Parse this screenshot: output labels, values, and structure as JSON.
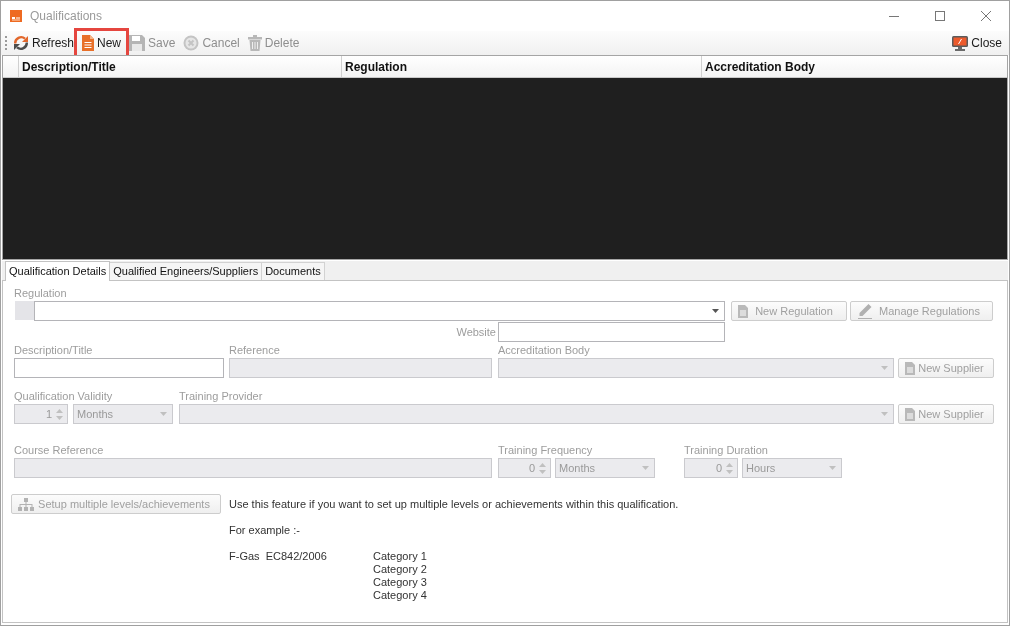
{
  "window": {
    "title": "Qualifications"
  },
  "toolbar": {
    "items": [
      {
        "kind": "refresh",
        "label": "Refresh",
        "disabled": false,
        "highlighted": false
      },
      {
        "kind": "new",
        "label": "New",
        "disabled": false,
        "highlighted": true
      },
      {
        "kind": "save",
        "label": "Save",
        "disabled": true,
        "highlighted": false
      },
      {
        "kind": "cancel",
        "label": "Cancel",
        "disabled": true,
        "highlighted": false
      },
      {
        "kind": "delete",
        "label": "Delete",
        "disabled": true,
        "highlighted": false
      }
    ],
    "close": {
      "label": "Close"
    }
  },
  "grid": {
    "columns": [
      "Description/Title",
      "Regulation",
      "Accreditation Body"
    ]
  },
  "tabs": [
    {
      "label": "Qualification Details",
      "selected": true
    },
    {
      "label": "Qualified Engineers/Suppliers",
      "selected": false
    },
    {
      "label": "Documents",
      "selected": false
    }
  ],
  "form": {
    "regulation": {
      "label": "Regulation",
      "disabled": false
    },
    "new_regulation": {
      "label": "New Regulation",
      "disabled": true
    },
    "manage_regulations": {
      "label": "Manage Regulations",
      "disabled": true
    },
    "website": {
      "label": "Website",
      "disabled": false
    },
    "description": {
      "label": "Description/Title",
      "disabled": false
    },
    "reference": {
      "label": "Reference",
      "disabled": true
    },
    "accreditation_body": {
      "label": "Accreditation Body",
      "disabled": true
    },
    "new_supplier_accreditation": {
      "label": "New Supplier",
      "disabled": true
    },
    "validity": {
      "label": "Qualification Validity",
      "value": "1",
      "unit": "Months",
      "disabled": true
    },
    "training_provider": {
      "label": "Training Provider",
      "disabled": true
    },
    "new_supplier_provider": {
      "label": "New Supplier",
      "disabled": true
    },
    "course_reference": {
      "label": "Course Reference",
      "disabled": true
    },
    "training_frequency": {
      "label": "Training Frequency",
      "value": "0",
      "unit": "Months",
      "disabled": true
    },
    "training_duration": {
      "label": "Training Duration",
      "value": "0",
      "unit": "Hours",
      "disabled": true
    },
    "setup_levels": {
      "label": "Setup multiple levels/achievements",
      "disabled": true
    }
  },
  "info": {
    "intro": "Use this feature if you want to set up multiple levels or achievements within this qualification.",
    "example_heading": "For example :-",
    "example_name": "F-Gas  EC842/2006",
    "example_categories": [
      "Category 1",
      "Category 2",
      "Category 3",
      "Category 4"
    ]
  }
}
